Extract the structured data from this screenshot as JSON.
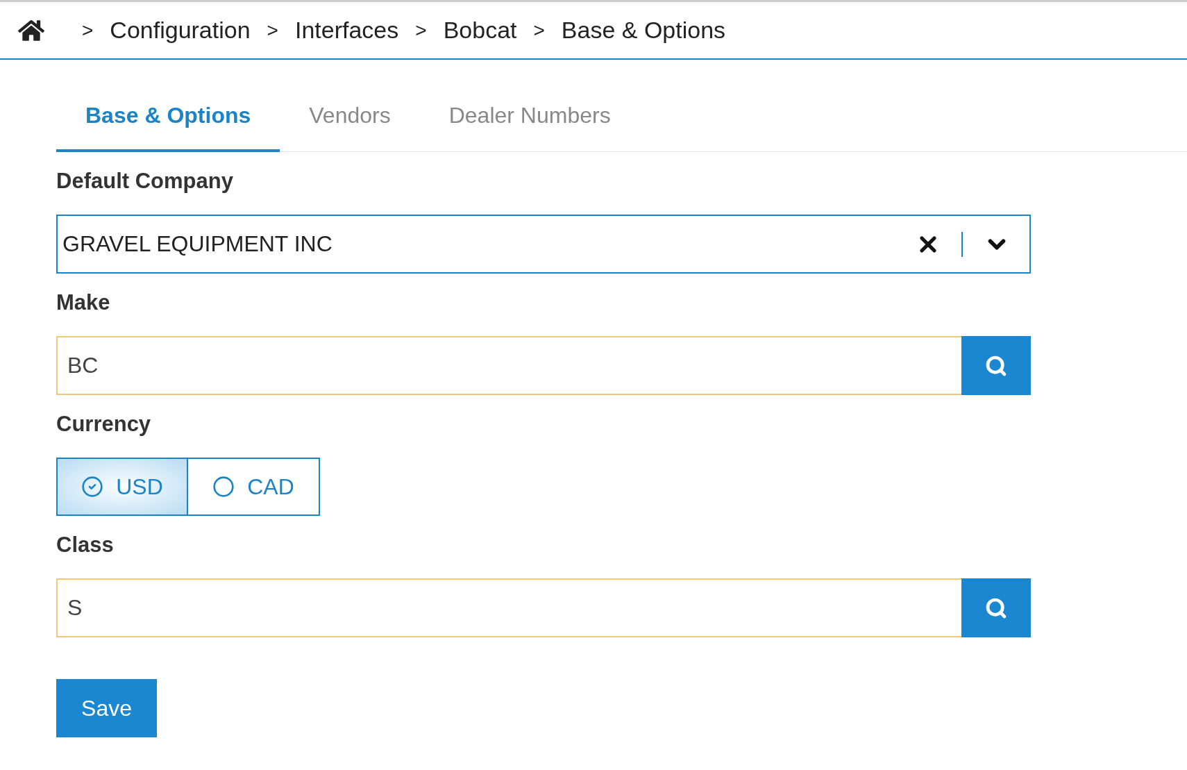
{
  "breadcrumb": [
    {
      "separator": ">",
      "label": "Configuration"
    },
    {
      "separator": ">",
      "label": "Interfaces"
    },
    {
      "separator": ">",
      "label": "Bobcat"
    },
    {
      "separator": ">",
      "label": "Base & Options"
    }
  ],
  "tabs": [
    {
      "label": "Base & Options",
      "selected": true
    },
    {
      "label": "Vendors",
      "selected": false
    },
    {
      "label": "Dealer Numbers",
      "selected": false
    }
  ],
  "fields": [
    {
      "kind": "select",
      "label": "Default Company",
      "value": "GRAVEL EQUIPMENT INC"
    },
    {
      "kind": "lookup",
      "label": "Make",
      "value": "BC"
    },
    {
      "kind": "toggle",
      "label": "Currency",
      "options": [
        {
          "label": "USD",
          "selected": true
        },
        {
          "label": "CAD",
          "selected": false
        }
      ]
    },
    {
      "kind": "lookup",
      "label": "Class",
      "value": "S"
    }
  ],
  "save_button": "Save"
}
